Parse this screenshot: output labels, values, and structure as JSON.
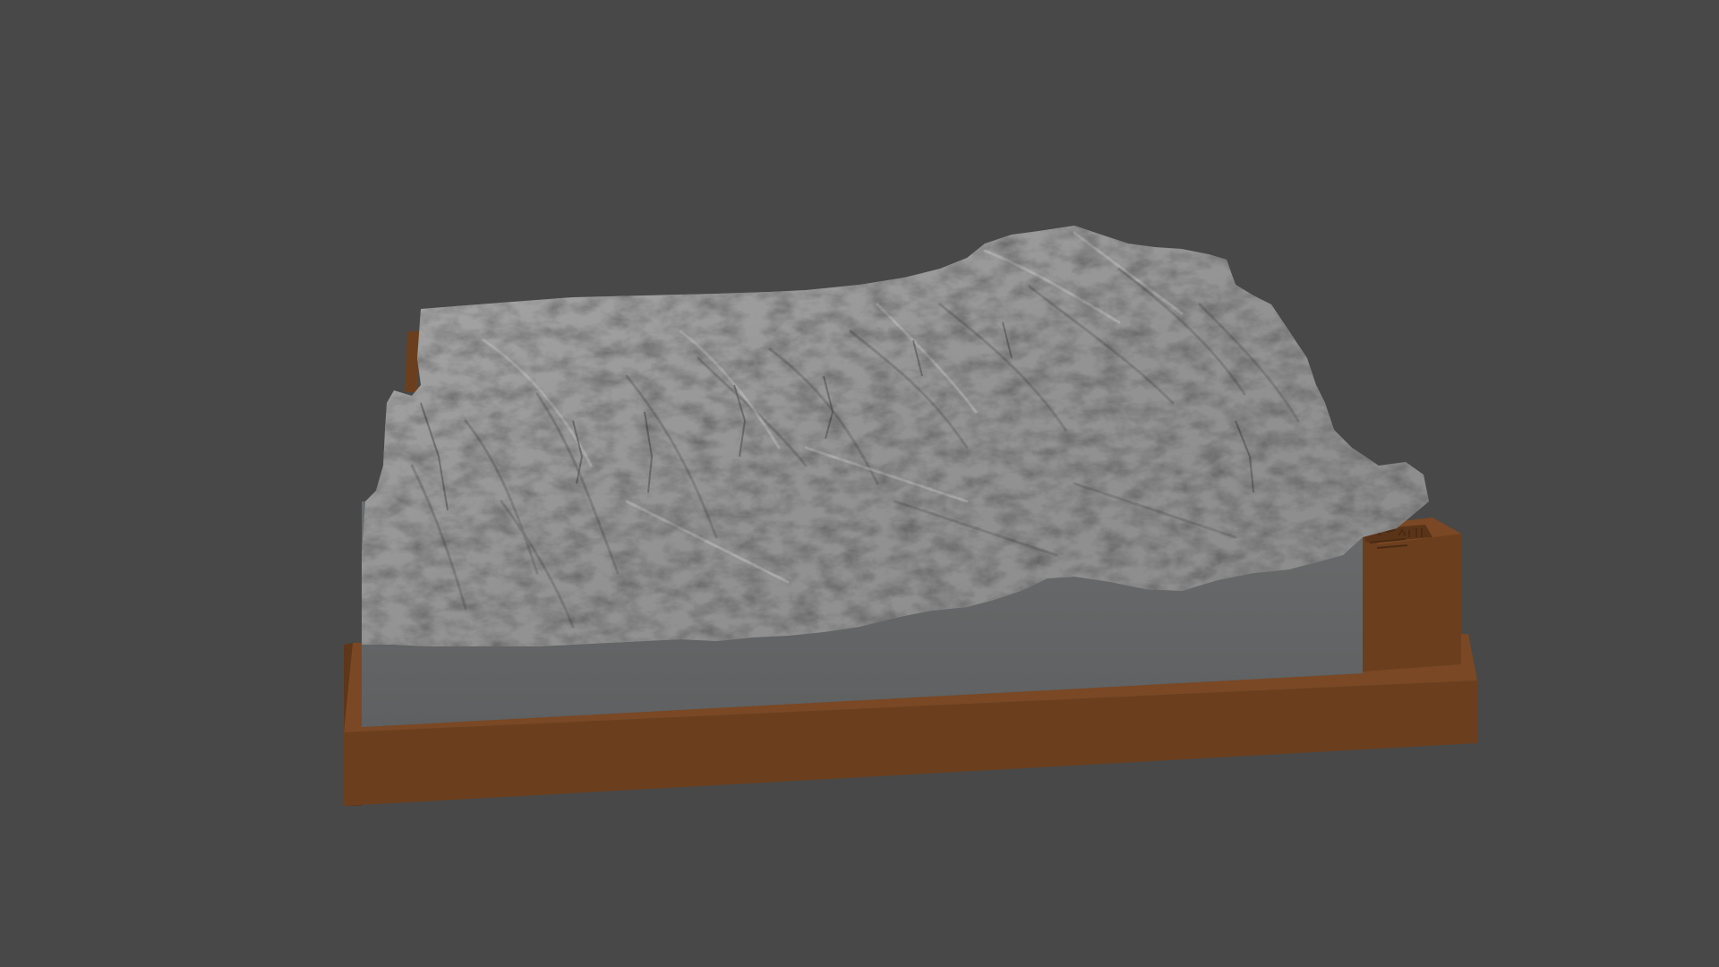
{
  "scene": {
    "background_color": "#484848",
    "terrain_color": "#9a9a9a",
    "terrain_side_color": "#626465",
    "base_color": "#6b3f1e",
    "base_top_color": "#7a4824"
  }
}
